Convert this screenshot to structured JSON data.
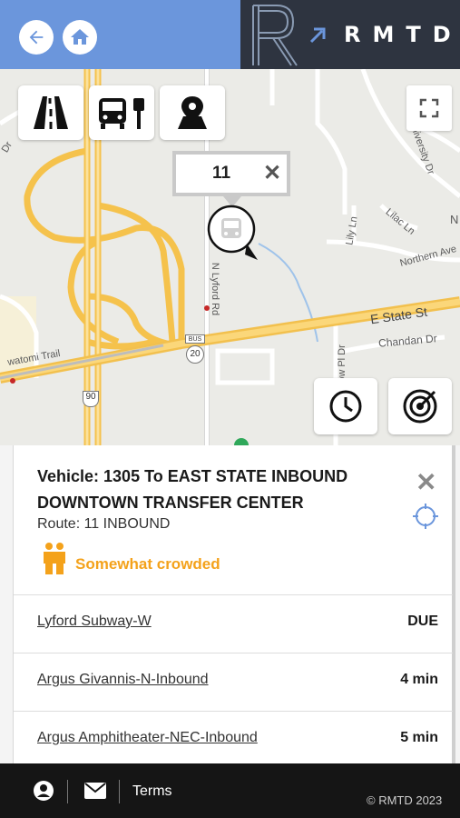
{
  "header": {
    "back_icon": "arrow-left-icon",
    "home_icon": "home-icon",
    "logo_text": "RMTD",
    "logo_mark": "R",
    "accent_color": "#6b96dc",
    "dark_color": "#2e3440"
  },
  "map": {
    "layer_buttons": [
      {
        "icon": "road-icon"
      },
      {
        "icon": "bus-stop-icon"
      },
      {
        "icon": "map-marker-icon"
      }
    ],
    "fullscreen_icon": "fullscreen-icon",
    "popup": {
      "route_number": "11",
      "close_symbol": "✕"
    },
    "vehicle_icon": "bus-icon",
    "side_buttons": [
      {
        "icon": "clock-icon"
      },
      {
        "icon": "radar-icon"
      }
    ],
    "labels": {
      "e_state_st": "E State St",
      "chandan_dr": "Chandan Dr",
      "northern_ave": "Northern Ave",
      "lilac_ln": "Lilac Ln",
      "lily_ln": "Lily Ln",
      "university_dr": "University Dr",
      "lyford_rd": "N Lyford Rd",
      "pow_pl": "ow Pl Dr",
      "watomi_trail": "watomi Trail",
      "i90": "90",
      "bus_20": "BUS",
      "rt_20": "20",
      "n_letter": "N",
      "dr_edge": "Dr"
    }
  },
  "panel": {
    "vehicle_title": "Vehicle: 1305 To EAST STATE INBOUND DOWNTOWN TRANSFER CENTER",
    "route": "Route: 11 INBOUND",
    "close_symbol": "✕",
    "crowding": "Somewhat crowded",
    "crowding_color": "#f4a21b",
    "stops": [
      {
        "name": "Lyford Subway-W",
        "time": "DUE"
      },
      {
        "name": "Argus Givannis-N-Inbound",
        "time": "4 min"
      },
      {
        "name": "Argus Amphitheater-NEC-Inbound",
        "time": "5 min"
      }
    ]
  },
  "footer": {
    "user_icon": "user-icon",
    "mail_icon": "mail-icon",
    "terms": "Terms",
    "copyright": "© RMTD 2023"
  }
}
